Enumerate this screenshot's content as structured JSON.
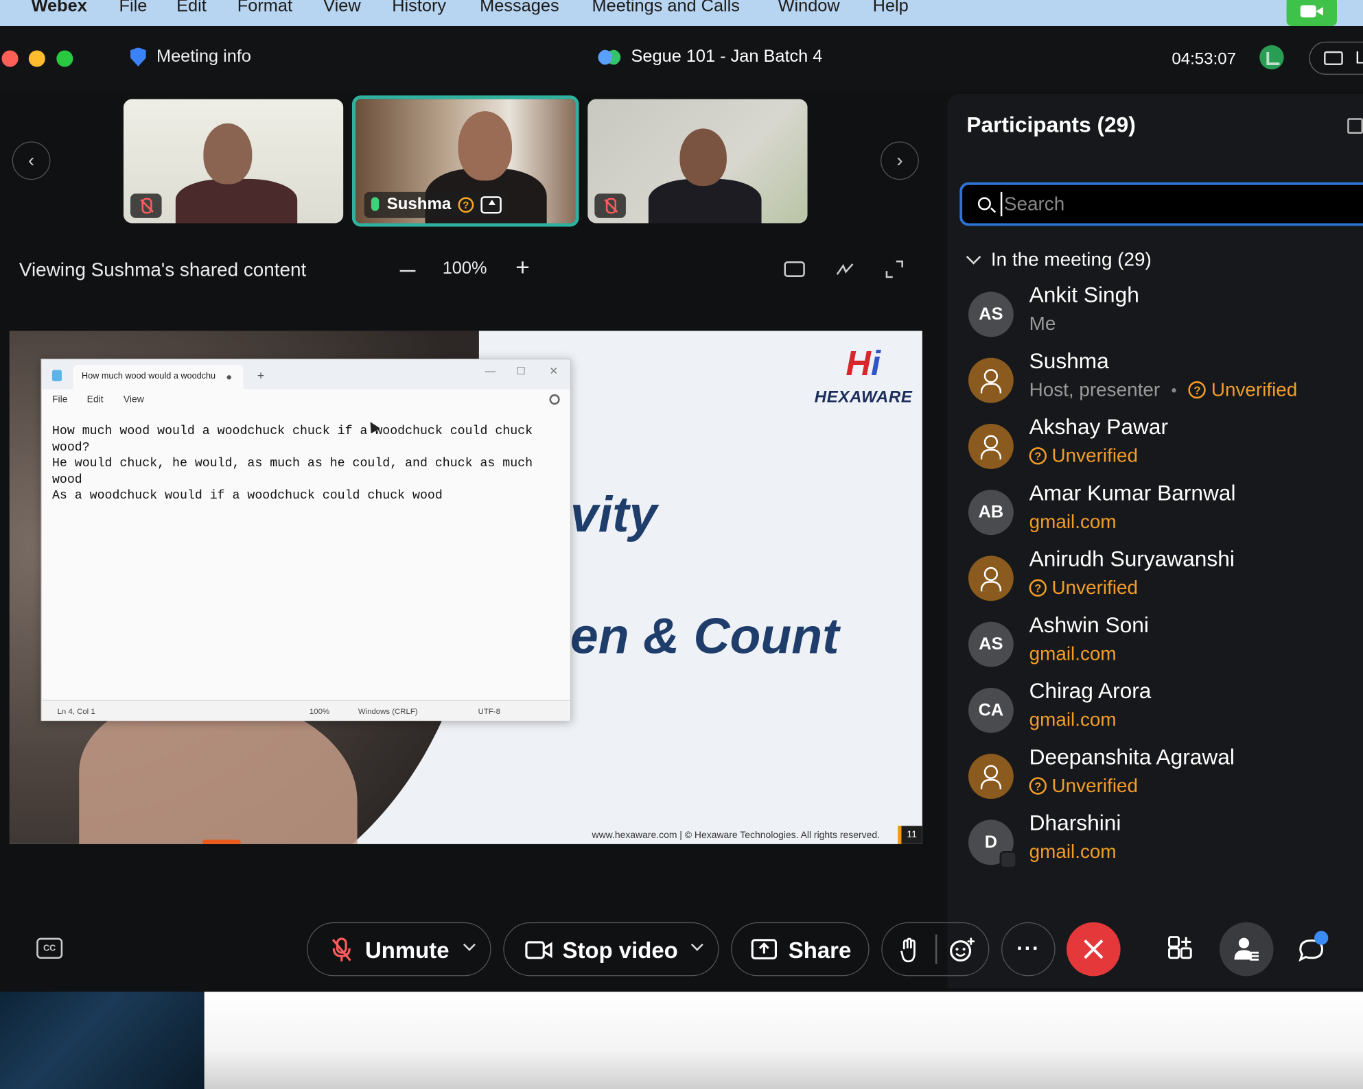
{
  "menubar": {
    "apple": "",
    "app_name": "Webex",
    "items": [
      "File",
      "Edit",
      "Format",
      "View",
      "History",
      "Messages",
      "Meetings and Calls",
      "Window",
      "Help"
    ]
  },
  "titlebar": {
    "meeting_info_label": "Meeting info",
    "meeting_title": "Segue 101 - Jan Batch 4",
    "timer": "04:53:07",
    "layout_button_label": "L"
  },
  "thumbnails": {
    "active_name": "Sushma",
    "active_badge": "?"
  },
  "share_toolbar": {
    "viewing_text": "Viewing Sushma's shared content",
    "zoom_level": "100%"
  },
  "slide": {
    "title_fragment_1": "vity",
    "title_fragment_2": "en & Count",
    "logo_word": "HEXAWARE",
    "logo_mark_red": "H",
    "logo_mark_blue": "i",
    "footer": "www.hexaware.com  | © Hexaware Technologies. All rights reserved.",
    "page_number": "11"
  },
  "notepad": {
    "tab_title": "How much wood would a woodchu",
    "plus": "+",
    "menu": [
      "File",
      "Edit",
      "View"
    ],
    "window_buttons": [
      "—",
      "☐",
      "✕"
    ],
    "content": "How much wood would a woodchuck chuck if a woodchuck could chuck\nwood?\nHe would chuck, he would, as much as he could, and chuck as much\nwood\nAs a woodchuck would if a woodchuck could chuck wood",
    "status": {
      "position": "Ln 4, Col 1",
      "zoom": "100%",
      "line_endings": "Windows (CRLF)",
      "encoding": "UTF-8"
    }
  },
  "participants": {
    "title": "Participants (29)",
    "search_placeholder": "Search",
    "section_label": "In the meeting (29)",
    "list": [
      {
        "initials": "AS",
        "name": "Ankit Singh",
        "sub": "Me",
        "sub_style": "gray",
        "avatar": "initials"
      },
      {
        "initials": "",
        "name": "Sushma",
        "sub": "Host, presenter",
        "sub_style": "gray",
        "extra": "Unverified",
        "avatar": "guest"
      },
      {
        "initials": "",
        "name": "Akshay Pawar",
        "sub": "Unverified",
        "sub_style": "orange-q",
        "avatar": "guest"
      },
      {
        "initials": "AB",
        "name": "Amar Kumar Barnwal",
        "sub": "gmail.com",
        "sub_style": "orange",
        "avatar": "initials"
      },
      {
        "initials": "",
        "name": "Anirudh Suryawanshi",
        "sub": "Unverified",
        "sub_style": "orange-q",
        "avatar": "guest"
      },
      {
        "initials": "AS",
        "name": "Ashwin Soni",
        "sub": "gmail.com",
        "sub_style": "orange",
        "avatar": "initials"
      },
      {
        "initials": "CA",
        "name": "Chirag Arora",
        "sub": "gmail.com",
        "sub_style": "orange",
        "avatar": "initials"
      },
      {
        "initials": "",
        "name": "Deepanshita Agrawal",
        "sub": "Unverified",
        "sub_style": "orange-q",
        "avatar": "guest"
      },
      {
        "initials": "D",
        "name": "Dharshini",
        "sub": "gmail.com",
        "sub_style": "orange",
        "avatar": "initials-badge"
      }
    ]
  },
  "controls": {
    "cc_label": "CC",
    "unmute_label": "Unmute",
    "stop_video_label": "Stop video",
    "share_label": "Share",
    "more_label": "···"
  },
  "colors": {
    "accent_blue": "#2e74d6",
    "unverified_orange": "#f29d28",
    "end_red": "#e5383b",
    "active_teal": "#2fb3a0",
    "menubar_bg": "#b7d4f0"
  }
}
